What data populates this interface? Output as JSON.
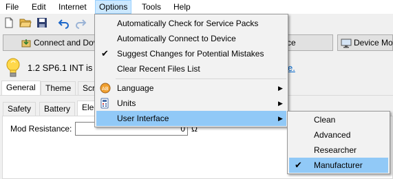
{
  "menubar": {
    "items": [
      "File",
      "Edit",
      "Internet",
      "Options",
      "Tools",
      "Help"
    ]
  },
  "toolbar": {
    "icons": [
      "new-file-icon",
      "open-folder-icon",
      "save-icon",
      "undo-icon",
      "redo-icon"
    ]
  },
  "buttons": {
    "connect": "Connect and Dov",
    "middle_tail": "ce",
    "device_monitor": "Device Mon"
  },
  "info": {
    "text": "1.2 SP6.1 INT is",
    "link_tail": "e."
  },
  "tabs_top": [
    "General",
    "Theme",
    "Scr"
  ],
  "tabs_inner": [
    "Safety",
    "Battery",
    "Elec"
  ],
  "mod_resistance": {
    "label": "Mod Resistance:",
    "value": "0",
    "unit": "Ω"
  },
  "options_menu": {
    "items": [
      {
        "label": "Automatically Check for Service Packs",
        "checked": false
      },
      {
        "label": "Automatically Connect to Device",
        "checked": false
      },
      {
        "label": "Suggest Changes for Potential Mistakes",
        "checked": true
      },
      {
        "label": "Clear Recent Files List",
        "checked": false
      },
      {
        "label": "Language",
        "icon": "language-icon",
        "submenu": true
      },
      {
        "label": "Units",
        "icon": "units-icon",
        "submenu": true
      },
      {
        "label": "User Interface",
        "submenu": true,
        "highlighted": true
      }
    ]
  },
  "ui_submenu": {
    "items": [
      {
        "label": "Clean",
        "checked": false
      },
      {
        "label": "Advanced",
        "checked": false
      },
      {
        "label": "Researcher",
        "checked": false
      },
      {
        "label": "Manufacturer",
        "checked": true,
        "highlighted": true
      }
    ]
  },
  "colors": {
    "menu_highlight": "#91c9f7",
    "menubar_open": "#cce8ff",
    "link": "#0066cc",
    "check": "#000000"
  }
}
